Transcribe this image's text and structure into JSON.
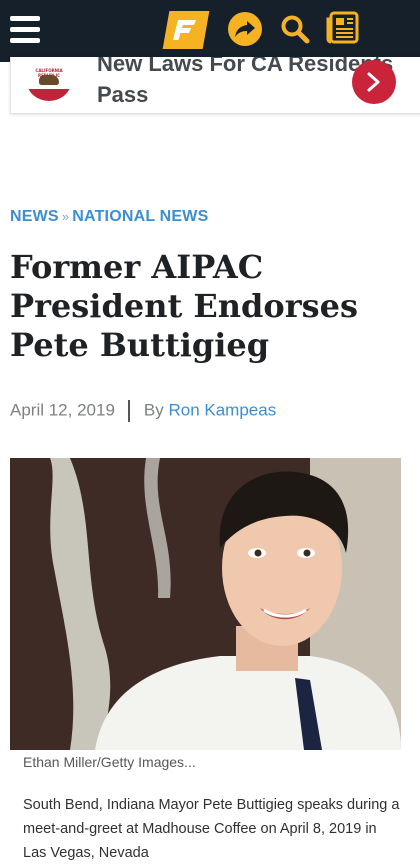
{
  "topbar": {
    "icons": [
      "menu-icon",
      "site-logo-icon",
      "share-icon",
      "search-icon",
      "newspaper-icon"
    ],
    "accent_color": "#f5b324",
    "background_color": "#15202b"
  },
  "ad": {
    "headline": "New Laws For CA Residents Pass",
    "flag_text": "CALIFORNIA REPUBLIC",
    "arrow_color": "#c9243a"
  },
  "breadcrumb": {
    "section": "NEWS",
    "separator": "»",
    "subsection": "NATIONAL NEWS"
  },
  "article": {
    "title": "Former AIPAC President Endorses Pete Buttigieg",
    "date": "April 12, 2019",
    "by_label": "By",
    "author": "Ron Kampeas",
    "photo_credit": "Ethan Miller/Getty Images...",
    "caption": "South Bend, Indiana Mayor Pete Buttigieg speaks during a meet-and-greet at Madhouse Coffee on April 8, 2019 in Las Vegas, Nevada"
  },
  "colors": {
    "link": "#3b8fd0",
    "title_text": "#1f2224"
  }
}
